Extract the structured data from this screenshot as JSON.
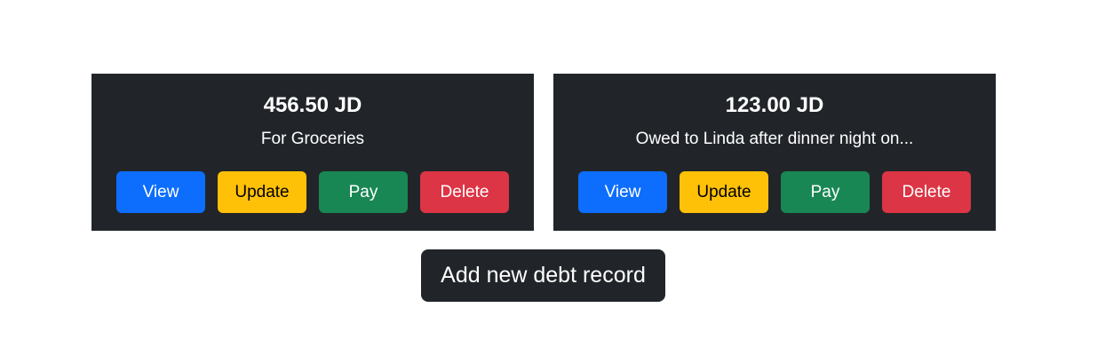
{
  "debts": [
    {
      "amount": "456.50 JD",
      "description": "For Groceries",
      "actions": {
        "view": "View",
        "update": "Update",
        "pay": "Pay",
        "delete": "Delete"
      }
    },
    {
      "amount": "123.00 JD",
      "description": "Owed to Linda after dinner night on...",
      "actions": {
        "view": "View",
        "update": "Update",
        "pay": "Pay",
        "delete": "Delete"
      }
    }
  ],
  "add_button": {
    "label": "Add new debt record"
  },
  "colors": {
    "card_bg": "#212529",
    "view": "#0d6efd",
    "update": "#ffc107",
    "pay": "#198754",
    "delete": "#dc3545"
  }
}
